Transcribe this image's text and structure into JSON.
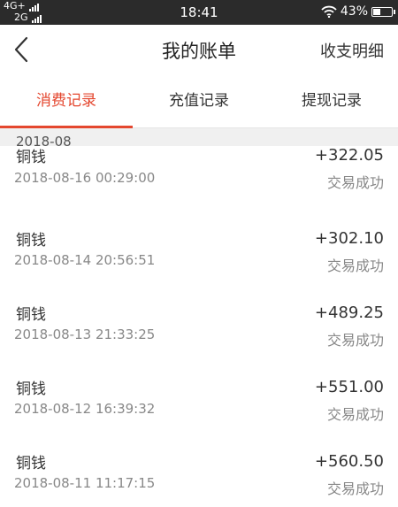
{
  "status_bar": {
    "network_top": "4G+",
    "network_bottom": "2G",
    "time": "18:41",
    "battery": "43%",
    "battery_level": 0.43
  },
  "header": {
    "title": "我的账单",
    "right_link": "收支明细",
    "back_icon": "chevron-left-icon"
  },
  "tabs": [
    {
      "label": "消费记录",
      "active": true
    },
    {
      "label": "充值记录",
      "active": false
    },
    {
      "label": "提现记录",
      "active": false
    }
  ],
  "month_header": "2018-08",
  "records": [
    {
      "name": "铜钱",
      "time": "2018-08-16 00:29:00",
      "amount": "+322.05",
      "status": "交易成功"
    },
    {
      "name": "铜钱",
      "time": "2018-08-14 20:56:51",
      "amount": "+302.10",
      "status": "交易成功"
    },
    {
      "name": "铜钱",
      "time": "2018-08-13 21:33:25",
      "amount": "+489.25",
      "status": "交易成功"
    },
    {
      "name": "铜钱",
      "time": "2018-08-12 16:39:32",
      "amount": "+551.00",
      "status": "交易成功"
    },
    {
      "name": "铜钱",
      "time": "2018-08-11 11:17:15",
      "amount": "+560.50",
      "status": "交易成功"
    }
  ],
  "colors": {
    "accent": "#e4472f",
    "status_bar": "#2b2b2b"
  }
}
